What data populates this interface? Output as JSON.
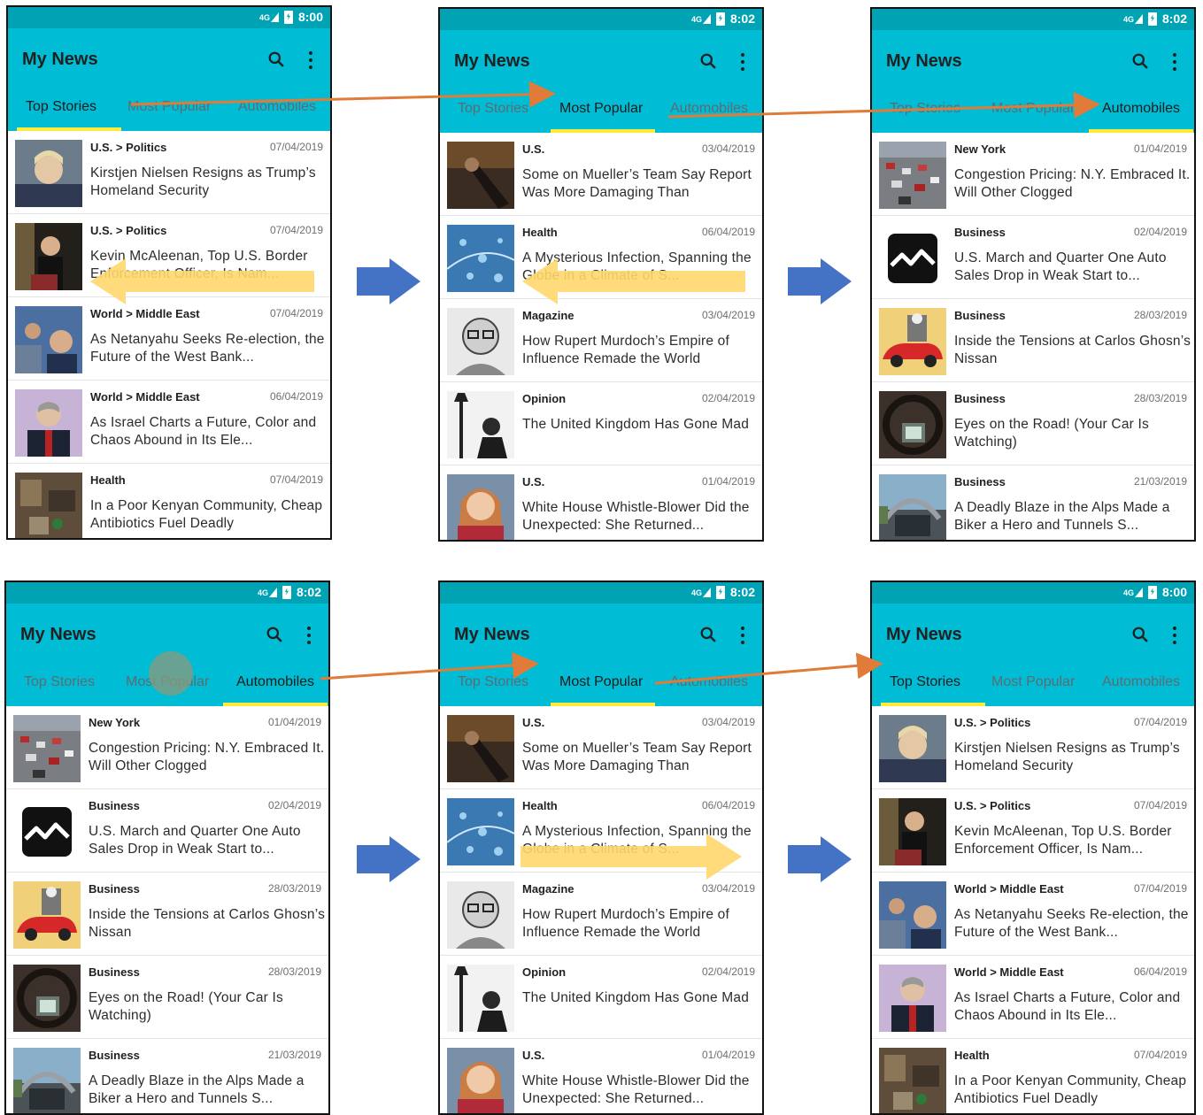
{
  "app_title": "My News",
  "tab_labels": [
    "Top Stories",
    "Most Popular",
    "Automobiles"
  ],
  "colors": {
    "status_bar": "#00a3b3",
    "app_bar": "#00bcd4",
    "tab_indicator": "#ffeb3b",
    "swipe_arrow": "#ffd76e",
    "flow_arrow": "#e07b39",
    "step_arrow": "#4472c4"
  },
  "icons": {
    "search": "search-icon",
    "overflow": "more-vert-icon",
    "signal": "signal-4g-icon",
    "battery": "battery-charging-icon"
  },
  "feeds": {
    "top_stories": [
      {
        "section": "U.S. > Politics",
        "date": "07/04/2019",
        "headline": "Kirstjen Nielsen Resigns as Trump’s Homeland Security",
        "thumb": "portrait-photo"
      },
      {
        "section": "U.S. > Politics",
        "date": "07/04/2019",
        "headline": "Kevin McAleenan, Top U.S. Border Enforcement Officer, Is Nam...",
        "thumb": "speaker-photo"
      },
      {
        "section": "World > Middle East",
        "date": "07/04/2019",
        "headline": "As Netanyahu Seeks Re-election, the Future of the West Bank...",
        "thumb": "crowd-photo"
      },
      {
        "section": "World > Middle East",
        "date": "06/04/2019",
        "headline": "As Israel Charts a Future, Color and Chaos Abound in Its Ele...",
        "thumb": "suit-portrait-photo"
      },
      {
        "section": "Health",
        "date": "07/04/2019",
        "headline": "In a Poor Kenyan Community, Cheap Antibiotics Fuel Deadly",
        "thumb": "rubble-photo"
      }
    ],
    "most_popular": [
      {
        "section": "U.S.",
        "date": "03/04/2019",
        "headline": "Some on Mueller’s Team Say Report Was More Damaging Than",
        "thumb": "dark-photo"
      },
      {
        "section": "Health",
        "date": "06/04/2019",
        "headline": "A Mysterious Infection, Spanning the Globe in a Climate of S...",
        "thumb": "microscope-photo"
      },
      {
        "section": "Magazine",
        "date": "03/04/2019",
        "headline": "How Rupert Murdoch’s Empire of Influence Remade the World",
        "thumb": "sketch-photo"
      },
      {
        "section": "Opinion",
        "date": "02/04/2019",
        "headline": "The United Kingdom Has Gone Mad",
        "thumb": "lamp-photo"
      },
      {
        "section": "U.S.",
        "date": "01/04/2019",
        "headline": "White House Whistle-Blower Did the Unexpected: She Returned...",
        "thumb": "woman-portrait-photo"
      }
    ],
    "automobiles": [
      {
        "section": "New York",
        "date": "01/04/2019",
        "headline": "Congestion Pricing: N.Y. Embraced It. Will Other Clogged",
        "thumb": "traffic-photo"
      },
      {
        "section": "Business",
        "date": "02/04/2019",
        "headline": "U.S. March and Quarter One Auto Sales Drop in Weak Start to...",
        "thumb": "chart-logo"
      },
      {
        "section": "Business",
        "date": "28/03/2019",
        "headline": "Inside the Tensions at Carlos Ghosn’s Nissan",
        "thumb": "car-illustration"
      },
      {
        "section": "Business",
        "date": "28/03/2019",
        "headline": "Eyes on the Road! (Your Car Is Watching)",
        "thumb": "dashboard-photo"
      },
      {
        "section": "Business",
        "date": "21/03/2019",
        "headline": "A Deadly Blaze in the Alps Made a Biker a Hero and Tunnels S...",
        "thumb": "tunnel-photo"
      }
    ]
  },
  "screens": [
    {
      "time": "8:00",
      "active_tab": 0,
      "feed": "top_stories",
      "swipe": "left"
    },
    {
      "time": "8:02",
      "active_tab": 1,
      "feed": "most_popular",
      "swipe": "left"
    },
    {
      "time": "8:02",
      "active_tab": 2,
      "feed": "automobiles",
      "swipe": "none"
    },
    {
      "time": "8:02",
      "active_tab": 2,
      "feed": "automobiles",
      "swipe": "tap"
    },
    {
      "time": "8:02",
      "active_tab": 1,
      "feed": "most_popular",
      "swipe": "right"
    },
    {
      "time": "8:00",
      "active_tab": 0,
      "feed": "top_stories",
      "swipe": "none"
    }
  ]
}
